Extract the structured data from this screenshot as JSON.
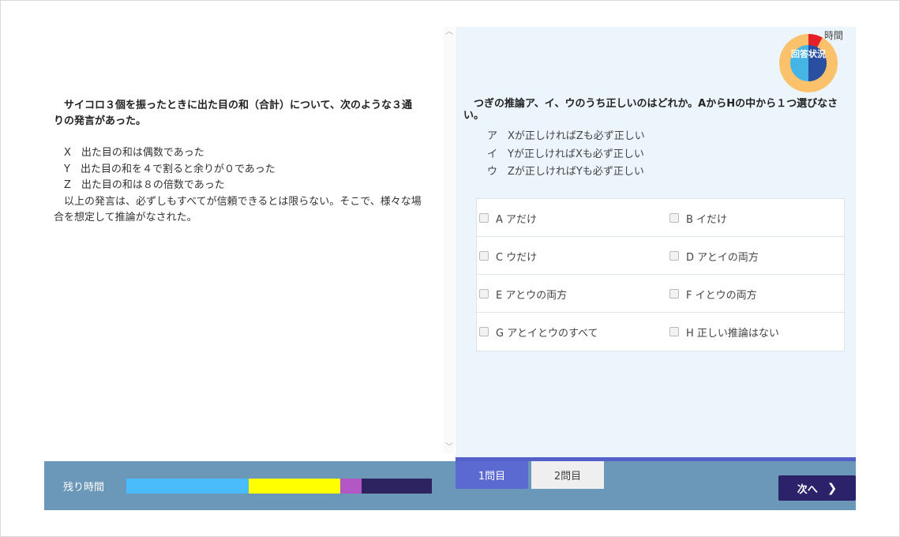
{
  "left": {
    "stem": "　サイコロ３個を振ったときに出た目の和（合計）について、次のような３通りの発言があった。",
    "statements": [
      "　X　出た目の和は偶数であった",
      "　Y　出た目の和を４で割ると余りが０であった",
      "　Z　出た目の和は８の倍数であった"
    ],
    "conclusion": "　以上の発言は、必ずしもすべてが信頼できるとは限らない。そこで、様々な場合を想定して推論がなされた。"
  },
  "right": {
    "question": "　つぎの推論ア、イ、ウのうち正しいのはどれか。AからHの中から１つ選びなさい。",
    "premises": [
      "ア　Xが正しければZも必ず正しい",
      "イ　Yが正しければXも必ず正しい",
      "ウ　Zが正しければYも必ず正しい"
    ],
    "choices": [
      [
        "A アだけ",
        "B イだけ"
      ],
      [
        "C ウだけ",
        "D アとイの両方"
      ],
      [
        "E アとウの両方",
        "F イとウの両方"
      ],
      [
        "G アとイとウのすべて",
        "H 正しい推論はない"
      ]
    ]
  },
  "status": {
    "time_label": "時間",
    "answer_status": "回答状況",
    "colors": {
      "ring": "#fbc16b",
      "elapsed": "#e5202a",
      "answered": "#2a4fa1",
      "unanswered": "#45b5e6"
    },
    "elapsed_fraction": 0.08,
    "answered_fraction": 0.5
  },
  "bottom": {
    "remaining_label": "残り時間",
    "timer_segments": [
      {
        "color": "#4bbcfb",
        "fraction": 0.4
      },
      {
        "color": "#ffff00",
        "fraction": 0.3
      },
      {
        "color": "#b257c4",
        "fraction": 0.07
      },
      {
        "color": "#2c2360",
        "fraction": 0.23
      }
    ],
    "tabs": [
      "1問目",
      "2問目"
    ],
    "next_label": "次へ"
  }
}
